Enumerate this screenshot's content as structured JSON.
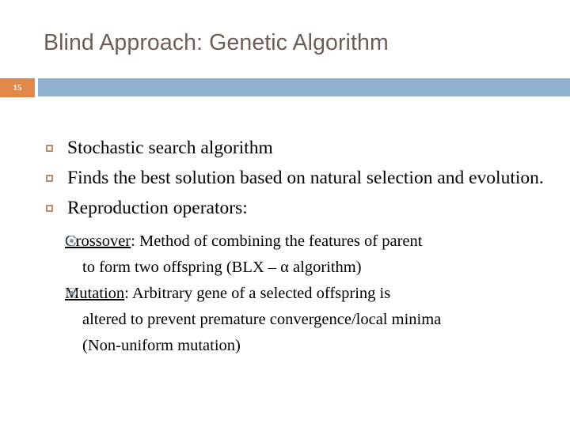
{
  "slide": {
    "title": "Blind Approach: Genetic Algorithm",
    "number": "15",
    "colors": {
      "title_text": "#6d5d55",
      "number_box": "#e0884a",
      "band_bar": "#8fb0d0",
      "level1_bullet": "#c08a68",
      "level2_bullet": "#8a9aa8",
      "body_text": "#000000",
      "background": "#ffffff"
    },
    "bullets": [
      {
        "bullet_icon": "hollow-square-bullet",
        "text": "Stochastic search algorithm"
      },
      {
        "bullet_icon": "hollow-square-bullet",
        "text": "Finds the best solution based on natural selection and evolution."
      },
      {
        "bullet_icon": "hollow-square-bullet",
        "text": "Reproduction operators:"
      }
    ],
    "sub_bullets": [
      {
        "bullet_icon": "ring-dot-bullet",
        "keyword": "Crossover",
        "line_1_rest": ": Method of combining the features of parent",
        "line_2": "to form two offspring (BLX – α algorithm)"
      },
      {
        "bullet_icon": "ring-dot-bullet",
        "keyword": "Mutation",
        "line_1_rest": ": Arbitrary gene of a selected offspring is",
        "line_2": "altered to prevent premature convergence/local minima",
        "line_3": "(Non-uniform mutation)"
      }
    ]
  }
}
